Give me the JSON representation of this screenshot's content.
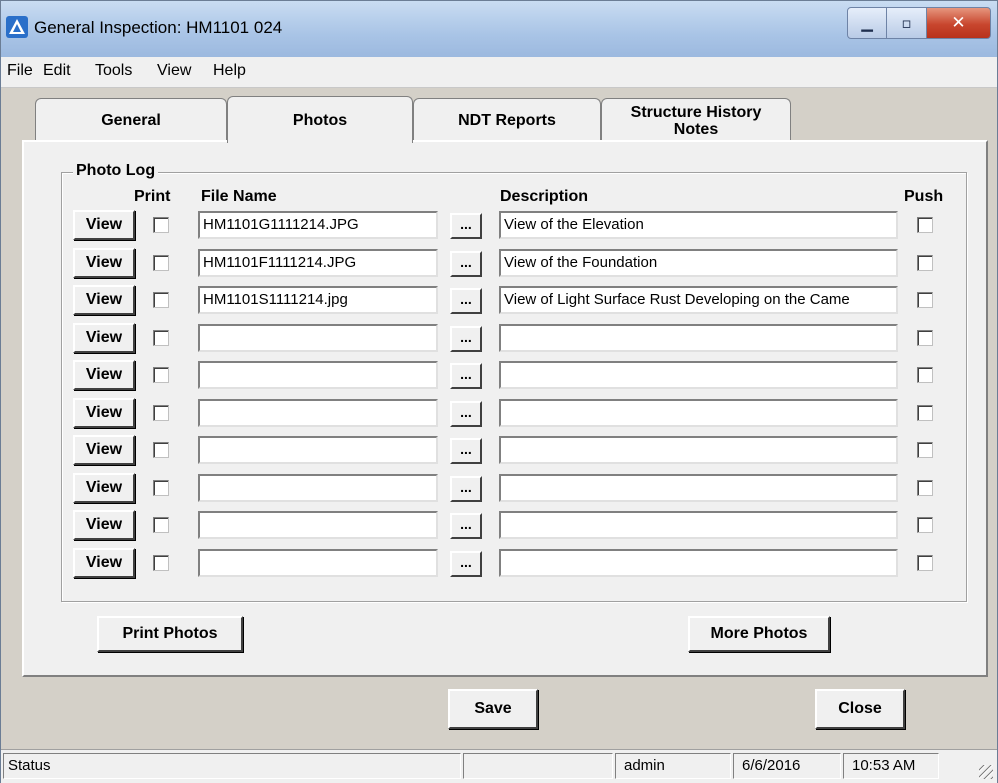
{
  "window": {
    "title": "General Inspection: HM1101 024"
  },
  "menu": [
    "File",
    "Edit",
    "Tools",
    "View",
    "Help"
  ],
  "tabs": [
    {
      "label": "General"
    },
    {
      "label": "Photos",
      "active": true
    },
    {
      "label": "NDT Reports"
    },
    {
      "label": "Structure History Notes"
    }
  ],
  "photo_log": {
    "group_label": "Photo Log",
    "headers": {
      "print": "Print",
      "file_name": "File Name",
      "description": "Description",
      "push": "Push"
    },
    "view_label": "View",
    "browse_label": "...",
    "rows": [
      {
        "file": "HM1101G1111214.JPG",
        "description": "View of the Elevation",
        "print": false,
        "push": false
      },
      {
        "file": "HM1101F1111214.JPG",
        "description": "View of the Foundation",
        "print": false,
        "push": false
      },
      {
        "file": "HM1101S1111214.jpg",
        "description": "View of Light Surface Rust Developing on the Came",
        "print": false,
        "push": false
      },
      {
        "file": "",
        "description": "",
        "print": false,
        "push": false
      },
      {
        "file": "",
        "description": "",
        "print": false,
        "push": false
      },
      {
        "file": "",
        "description": "",
        "print": false,
        "push": false
      },
      {
        "file": "",
        "description": "",
        "print": false,
        "push": false
      },
      {
        "file": "",
        "description": "",
        "print": false,
        "push": false
      },
      {
        "file": "",
        "description": "",
        "print": false,
        "push": false
      },
      {
        "file": "",
        "description": "",
        "print": false,
        "push": false
      }
    ]
  },
  "buttons": {
    "print_photos": "Print Photos",
    "more_photos": "More Photos",
    "save": "Save",
    "close": "Close"
  },
  "status": {
    "label": "Status",
    "blank": "",
    "user": "admin",
    "date": "6/6/2016",
    "time": "10:53 AM"
  },
  "icons": [
    "app-icon",
    "minimize-icon",
    "maximize-icon",
    "close-icon",
    "resize-grip-icon"
  ]
}
